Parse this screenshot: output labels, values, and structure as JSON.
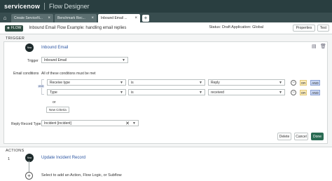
{
  "appbar": {
    "brand": "servicenow",
    "app_title": "Flow Designer"
  },
  "tabs": [
    {
      "label": "Create ServiceN...",
      "active": false
    },
    {
      "label": "Benchmark Rec...",
      "active": false
    },
    {
      "label": "Inbound Email ...",
      "active": true
    }
  ],
  "tab_close": "×",
  "new_tab": "+",
  "header": {
    "badge": "FLOW",
    "title": "Inbound Email Flow Example: handling email replies",
    "status": "Status: Draft  Application: Global",
    "properties": "Properties",
    "test": "Test"
  },
  "trigger": {
    "section": "TRIGGER",
    "node_icon": "flow",
    "name": "Inbound Email",
    "trigger_label": "Trigger",
    "trigger_value": "Inbound Email",
    "email_conditions_label": "Email conditions",
    "conditions_hint": "All of these conditions must be met",
    "and_tag": "AND",
    "conditions": [
      {
        "field": "Receive type",
        "operator": "is",
        "value": "Reply"
      },
      {
        "field": "Type",
        "operator": "is",
        "value": "received"
      }
    ],
    "or_label": "or",
    "or_btn": "OR",
    "and_btn": "AND",
    "new_criteria": "New Criteria",
    "reply_label": "Reply Record Type",
    "reply_value": "Incident [incident]",
    "delete": "Delete",
    "cancel": "Cancel",
    "done": "Done"
  },
  "actions": {
    "section": "ACTIONS",
    "step_number": "1",
    "node_icon": "flow",
    "action_name": "Update Incident Record",
    "add_hint": "Select to add an Action, Flow Logic, or Subflow"
  },
  "colors": {
    "appbar": "#293e40",
    "done": "#2a6b53",
    "link": "#2d57a3"
  }
}
